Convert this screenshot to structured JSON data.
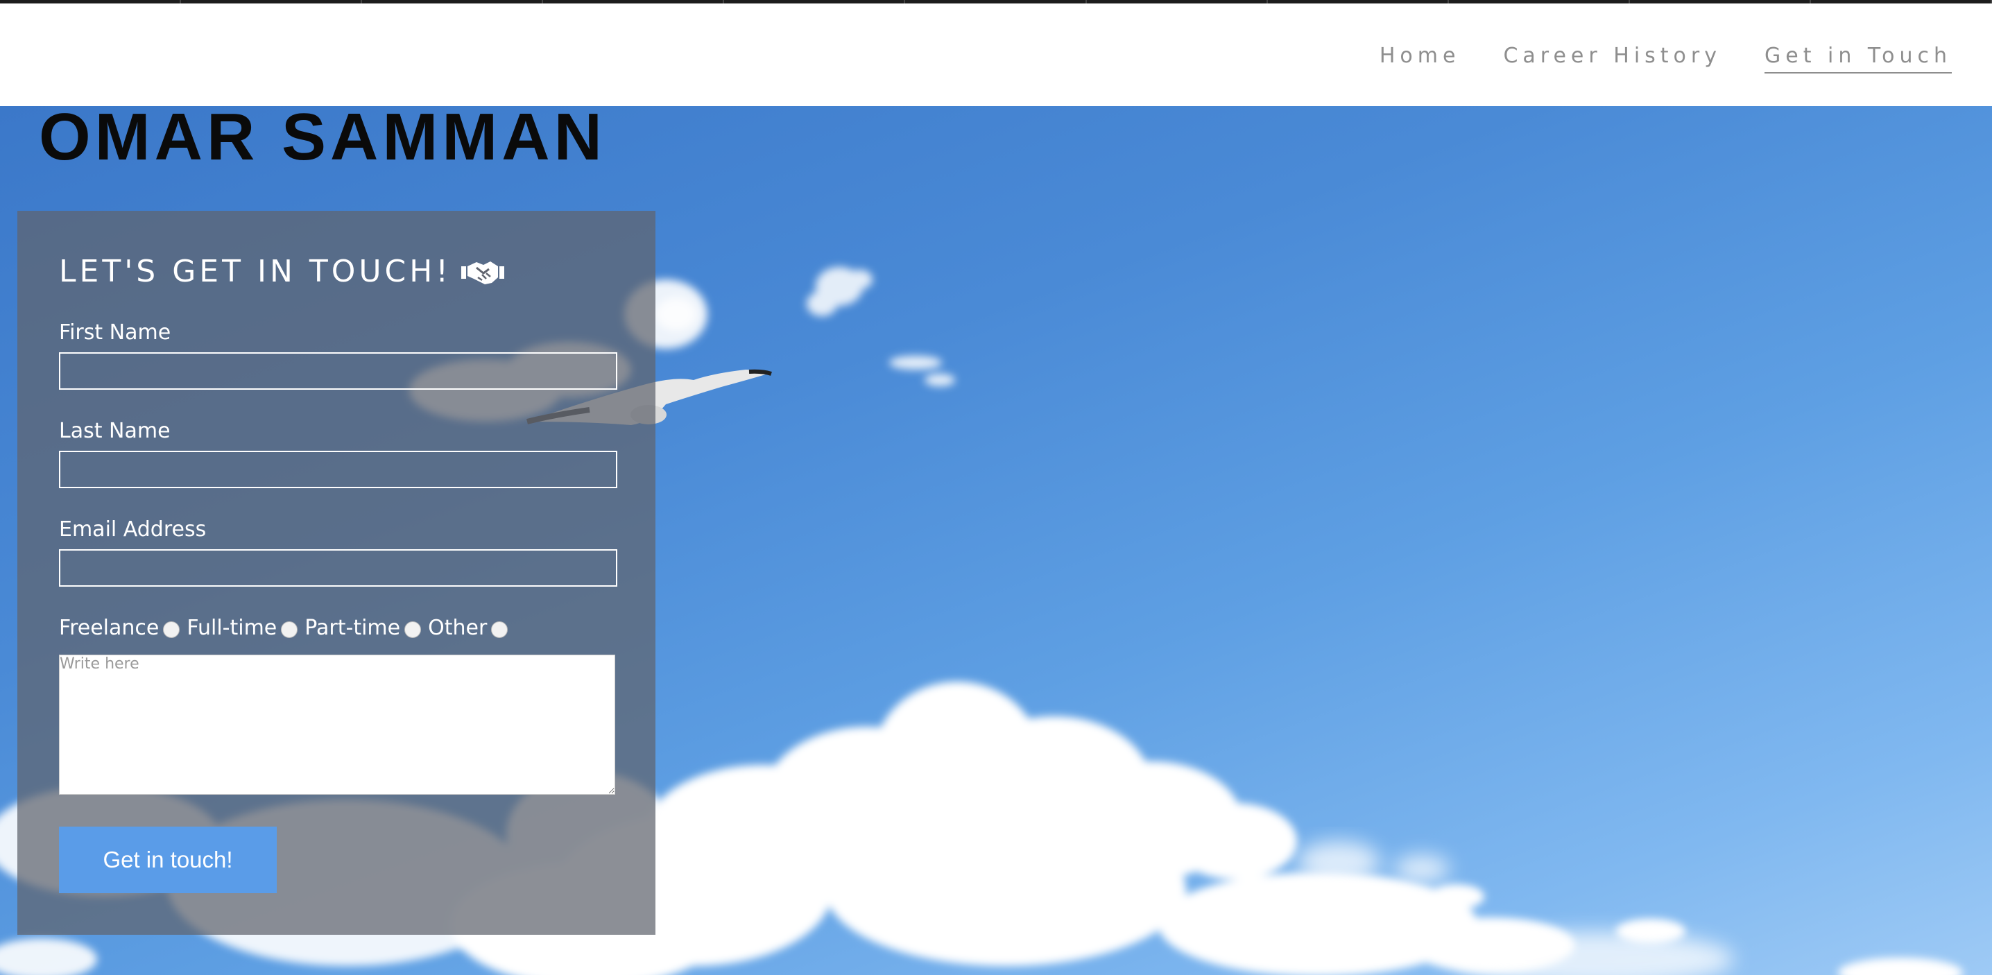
{
  "nav": {
    "items": [
      {
        "label": "Home"
      },
      {
        "label": "Career History"
      },
      {
        "label": "Get in Touch"
      }
    ],
    "active_index": 2
  },
  "site": {
    "title": "OMAR SAMMAN"
  },
  "form": {
    "title": "LET'S GET IN TOUCH!",
    "title_icon": "handshake-icon",
    "first_name_label": "First Name",
    "first_name_value": "",
    "last_name_label": "Last Name",
    "last_name_value": "",
    "email_label": "Email Address",
    "email_value": "",
    "options": [
      "Freelance",
      "Full-time",
      "Part-time",
      "Other"
    ],
    "message_placeholder": "Write here",
    "message_value": "",
    "submit_label": "Get in touch!"
  },
  "colors": {
    "nav_text": "#8e8e8e",
    "panel_overlay": "#60646e",
    "button": "#5a9ce8",
    "sky": "#4a8ad6"
  }
}
